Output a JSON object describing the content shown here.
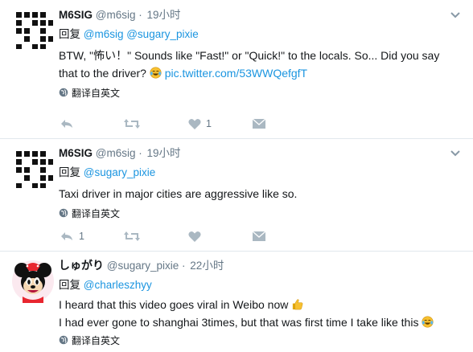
{
  "tweets": [
    {
      "name": "M6SIG",
      "handle": "@m6sig",
      "dot": "·",
      "time": "19小时",
      "reply_prefix": "回复",
      "reply_to": "@m6sig @sugary_pixie",
      "text_line1": "BTW, \"怖い！\" Sounds like \"Fast!\" or \"Quick!\" to the locals. So... Did you say",
      "text_line2_pre": "that to the driver?",
      "emoji_after_line2": "laughing-tears-emoji",
      "text_line2_link": "pic.twitter.com/53WWQefgfT",
      "translate": "翻译自英文",
      "reply_count": "",
      "retweet_count": "",
      "like_count": "1"
    },
    {
      "name": "M6SIG",
      "handle": "@m6sig",
      "dot": "·",
      "time": "19小时",
      "reply_prefix": "回复",
      "reply_to": "@sugary_pixie",
      "text_line1": "Taxi driver in major cities are aggressive like so.",
      "translate": "翻译自英文",
      "reply_count": "1",
      "retweet_count": "",
      "like_count": ""
    },
    {
      "name": "しゅがり",
      "handle": "@sugary_pixie",
      "dot": "·",
      "time": "22小时",
      "reply_prefix": "回复",
      "reply_to": "@charleszhyy",
      "text_line1": "I heard that this video goes viral in Weibo now",
      "emoji_after_line1": "thumbs-up-emoji",
      "text_line2": "I had ever gone to shanghai 3times, but that was first time I take like this",
      "emoji_after_line2": "laughing-tears-emoji",
      "translate": "翻译自英文"
    }
  ],
  "colors": {
    "link": "#1b95e0",
    "muted": "#657786",
    "divider": "#e1e8ed"
  }
}
